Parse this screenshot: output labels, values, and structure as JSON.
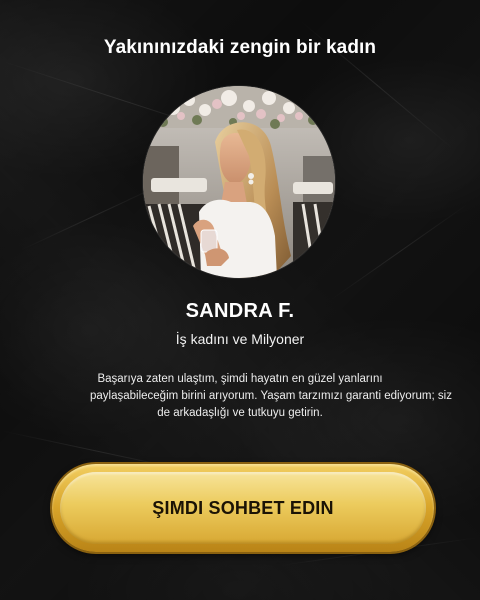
{
  "headline": "Yakınınızdaki zengin bir kadın",
  "profile": {
    "name": "SANDRA F.",
    "subtitle": "İş kadını ve Milyoner",
    "bio_lines": [
      "Başarıya zaten ulaştım, şimdi hayatın en güzel yanlarını",
      "paylaşabileceğim birini arıyorum. Yaşam tarzımızı garanti ediyorum; siz",
      "de arkadaşlığı ve tutkuyu getirin."
    ]
  },
  "cta": {
    "label": "ŞIMDI SOHBET EDIN"
  },
  "colors": {
    "background": "#0d0d0d",
    "text": "#ffffff",
    "cta_gold": "#e3b84a",
    "cta_text": "#1b1305"
  }
}
